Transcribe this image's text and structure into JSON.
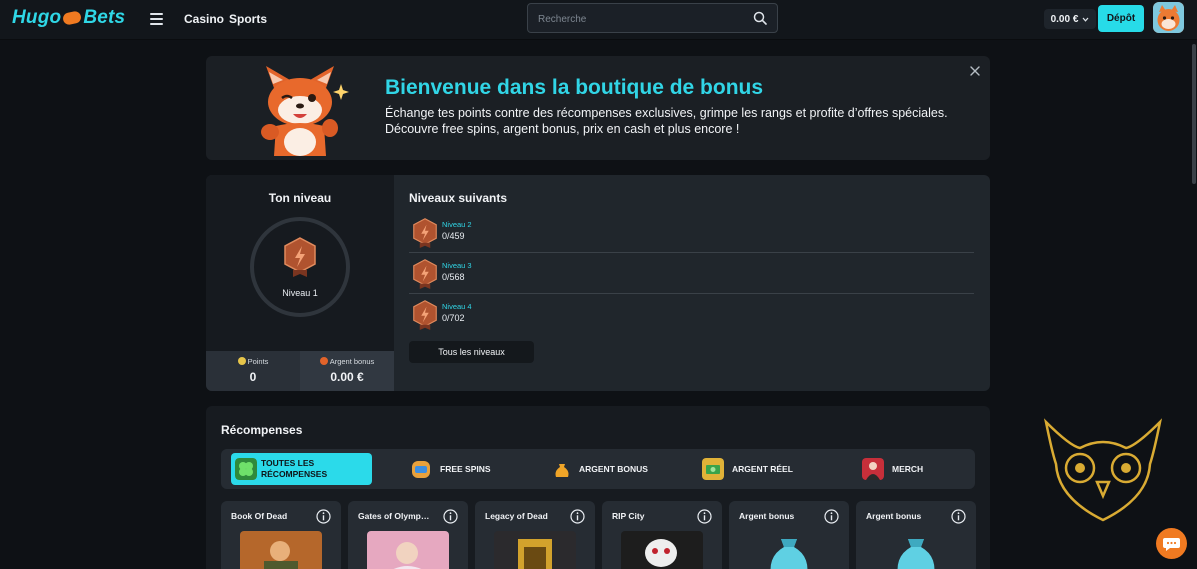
{
  "header": {
    "logo_left": "Hugo",
    "logo_right": "Bets",
    "nav": [
      "Casino",
      "Sports"
    ],
    "search_placeholder": "Recherche",
    "balance": "0.00 €",
    "deposit_label": "Dépôt"
  },
  "banner": {
    "title": "Bienvenue dans la boutique de bonus",
    "text": "Échange tes points contre des récompenses exclusives, grimpe les rangs et profite d’offres spéciales. Découvre free spins, argent bonus, prix en cash et plus encore !"
  },
  "level": {
    "title": "Ton niveau",
    "current": "Niveau 1",
    "points_label": "Points",
    "points_value": "0",
    "bonus_label": "Argent bonus",
    "bonus_value": "0.00 €",
    "next_title": "Niveaux suivants",
    "next": [
      {
        "name": "Niveau 2",
        "progress": "0/459"
      },
      {
        "name": "Niveau 3",
        "progress": "0/568"
      },
      {
        "name": "Niveau 4",
        "progress": "0/702"
      }
    ],
    "all_levels": "Tous les niveaux"
  },
  "rewards": {
    "title": "Récompenses",
    "filters": [
      "TOUTES LES RÉCOMPENSES",
      "FREE SPINS",
      "ARGENT BONUS",
      "ARGENT RÉEL",
      "MERCH"
    ],
    "cards": [
      "Book Of Dead",
      "Gates of Olymp…",
      "Legacy of Dead",
      "RIP City",
      "Argent bonus",
      "Argent bonus"
    ]
  },
  "colors": {
    "accent": "#2bdaea",
    "background": "#0e1115",
    "panel": "#1b1f24",
    "brand_orange": "#f07a21"
  }
}
